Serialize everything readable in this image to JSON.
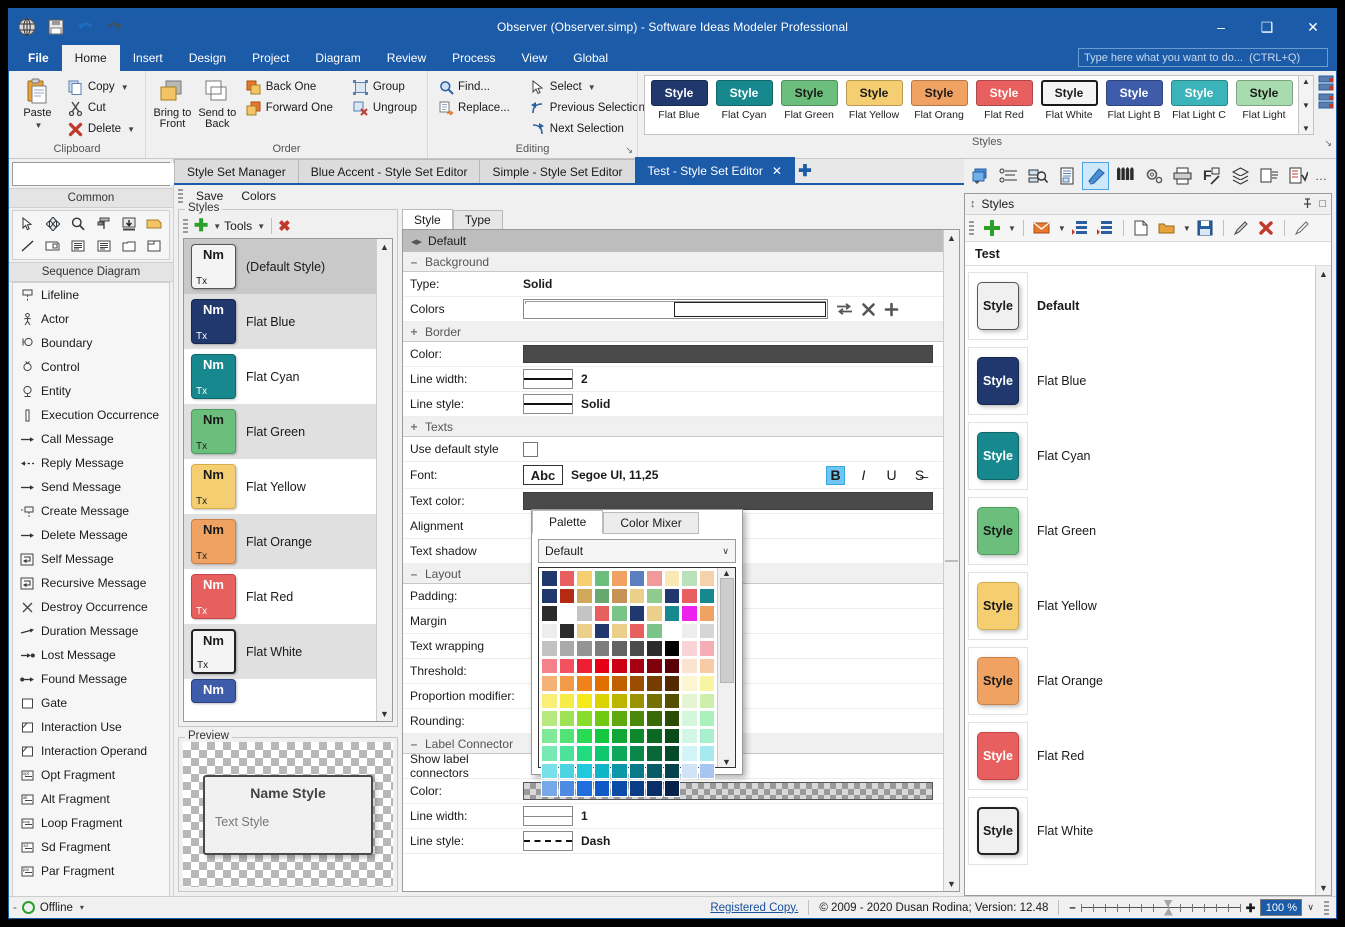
{
  "window": {
    "title": "Observer (Observer.simp)  - Software Ideas Modeler Professional",
    "minimize": "–",
    "maximize": "❑",
    "close": "✕"
  },
  "quick_access": [
    "app-logo-icon",
    "save-icon",
    "undo-icon",
    "redo-icon"
  ],
  "menu": {
    "tabs": [
      {
        "label": "File",
        "active": false,
        "file": true
      },
      {
        "label": "Home",
        "active": true
      },
      {
        "label": "Insert",
        "active": false
      },
      {
        "label": "Design",
        "active": false
      },
      {
        "label": "Project",
        "active": false
      },
      {
        "label": "Diagram",
        "active": false
      },
      {
        "label": "Review",
        "active": false
      },
      {
        "label": "Process",
        "active": false
      },
      {
        "label": "View",
        "active": false
      },
      {
        "label": "Global",
        "active": false
      }
    ],
    "tell_me_placeholder": "Type here what you want to do...  (CTRL+Q)"
  },
  "ribbon": {
    "groups": [
      {
        "name": "Clipboard",
        "big": [
          {
            "label": "Paste",
            "icon": "paste-icon",
            "dropdown": true
          }
        ],
        "small": [
          {
            "label": "Copy",
            "icon": "copy-icon",
            "dropdown": true
          },
          {
            "label": "Cut",
            "icon": "cut-icon",
            "dropdown": false
          },
          {
            "label": "Delete",
            "icon": "delete-icon",
            "dropdown": true
          }
        ]
      },
      {
        "name": "Order",
        "big": [
          {
            "label": "Bring to Front",
            "icon": "bring-to-front-icon"
          },
          {
            "label": "Send to Back",
            "icon": "send-to-back-icon"
          }
        ],
        "small": [
          {
            "label": "Back One",
            "icon": "back-one-icon"
          },
          {
            "label": "Forward One",
            "icon": "forward-one-icon"
          }
        ],
        "small2": [
          {
            "label": "Group",
            "icon": "group-icon"
          },
          {
            "label": "Ungroup",
            "icon": "ungroup-icon"
          }
        ]
      },
      {
        "name": "Editing",
        "small": [
          {
            "label": "Find...",
            "icon": "find-icon"
          },
          {
            "label": "Replace...",
            "icon": "replace-icon"
          }
        ],
        "small2": [
          {
            "label": "Select",
            "icon": "select-icon",
            "dropdown": true
          },
          {
            "label": "Previous Selection",
            "icon": "previous-selection-icon"
          },
          {
            "label": "Next Selection",
            "icon": "next-selection-icon"
          }
        ],
        "dialog_launcher": "↘"
      },
      {
        "name": "Styles",
        "dialog_launcher": "↘"
      }
    ],
    "gallery": {
      "chip_text": "Style",
      "items": [
        {
          "label": "Flat Blue",
          "bg": "#21386e",
          "fg": "#ffffff"
        },
        {
          "label": "Flat Cyan",
          "bg": "#17898e",
          "fg": "#ffffff"
        },
        {
          "label": "Flat Green",
          "bg": "#6cbe7d",
          "fg": "#1a1a1a"
        },
        {
          "label": "Flat Yellow",
          "bg": "#f4ce71",
          "fg": "#1a1a1a"
        },
        {
          "label": "Flat Orang",
          "bg": "#f0a263",
          "fg": "#1a1a1a"
        },
        {
          "label": "Flat Red",
          "bg": "#e85f5f",
          "fg": "#ffffff"
        },
        {
          "label": "Flat White",
          "bg": "#f4f4f4",
          "fg": "#1a1a1a"
        },
        {
          "label": "Flat Light B",
          "bg": "#3f5cab",
          "fg": "#ffffff"
        },
        {
          "label": "Flat Light C",
          "bg": "#3cb3b8",
          "fg": "#ffffff"
        },
        {
          "label": "Flat Light",
          "bg": "#a8dcae",
          "fg": "#1a1a1a"
        }
      ]
    }
  },
  "toolbox": {
    "search_placeholder": "",
    "search_value": "",
    "common_header": "Common",
    "common_icons": [
      "pointer-icon",
      "move-icon",
      "zoom-icon",
      "format-painter-icon",
      "insert-icon",
      "note-icon",
      "line-icon",
      "image-icon",
      "text-block-icon",
      "text-lines-icon",
      "container-icon",
      "frame-icon"
    ],
    "section_header": "Sequence Diagram",
    "items": [
      {
        "label": "Lifeline",
        "icon": "lifeline-icon"
      },
      {
        "label": "Actor",
        "icon": "actor-icon"
      },
      {
        "label": "Boundary",
        "icon": "boundary-icon"
      },
      {
        "label": "Control",
        "icon": "control-icon"
      },
      {
        "label": "Entity",
        "icon": "entity-icon"
      },
      {
        "label": "Execution Occurrence",
        "icon": "execution-occurrence-icon"
      },
      {
        "label": "Call Message",
        "icon": "call-message-icon"
      },
      {
        "label": "Reply Message",
        "icon": "reply-message-icon"
      },
      {
        "label": "Send Message",
        "icon": "send-message-icon"
      },
      {
        "label": "Create Message",
        "icon": "create-message-icon"
      },
      {
        "label": "Delete Message",
        "icon": "delete-message-icon"
      },
      {
        "label": "Self Message",
        "icon": "self-message-icon"
      },
      {
        "label": "Recursive Message",
        "icon": "recursive-message-icon"
      },
      {
        "label": "Destroy Occurrence",
        "icon": "destroy-occurrence-icon"
      },
      {
        "label": "Duration Message",
        "icon": "duration-message-icon"
      },
      {
        "label": "Lost Message",
        "icon": "lost-message-icon"
      },
      {
        "label": "Found Message",
        "icon": "found-message-icon"
      },
      {
        "label": "Gate",
        "icon": "gate-icon"
      },
      {
        "label": "Interaction Use",
        "icon": "interaction-use-icon"
      },
      {
        "label": "Interaction Operand",
        "icon": "interaction-operand-icon"
      },
      {
        "label": "Opt Fragment",
        "icon": "opt-fragment-icon"
      },
      {
        "label": "Alt Fragment",
        "icon": "alt-fragment-icon"
      },
      {
        "label": "Loop Fragment",
        "icon": "loop-fragment-icon"
      },
      {
        "label": "Sd Fragment",
        "icon": "sd-fragment-icon"
      },
      {
        "label": "Par Fragment",
        "icon": "par-fragment-icon"
      }
    ]
  },
  "doc_tabs": {
    "tabs": [
      {
        "label": "Style Set Manager",
        "active": false,
        "closable": false
      },
      {
        "label": "Blue Accent - Style Set Editor",
        "active": false,
        "closable": false
      },
      {
        "label": "Simple - Style Set Editor",
        "active": false,
        "closable": false
      },
      {
        "label": "Test - Style Set Editor",
        "active": true,
        "closable": true
      }
    ],
    "close_glyph": "✕",
    "add_glyph": "✚"
  },
  "editor": {
    "toolbar": [
      {
        "label": "Save"
      },
      {
        "label": "Colors"
      }
    ],
    "styles_group": {
      "legend": "Styles",
      "add_label": "✚",
      "tools_label": "Tools",
      "delete_label": "✖",
      "list": [
        {
          "name": "(Default Style)",
          "bg": "#f4f4f4",
          "fg": "#1a1a1a",
          "border": "#555555",
          "selected": true
        },
        {
          "name": "Flat Blue",
          "bg": "#21386e",
          "fg": "#ffffff",
          "border": "#15264c",
          "alt": true
        },
        {
          "name": "Flat Cyan",
          "bg": "#17898e",
          "fg": "#ffffff",
          "border": "#0f6569"
        },
        {
          "name": "Flat Green",
          "bg": "#6cbe7d",
          "fg": "#1a1a1a",
          "border": "#4c9c5d",
          "alt": true
        },
        {
          "name": "Flat Yellow",
          "bg": "#f4ce71",
          "fg": "#1a1a1a",
          "border": "#d4ac4b"
        },
        {
          "name": "Flat Orange",
          "bg": "#f0a263",
          "fg": "#1a1a1a",
          "border": "#cf8143",
          "alt": true
        },
        {
          "name": "Flat Red",
          "bg": "#e85f5f",
          "fg": "#ffffff",
          "border": "#c54545"
        },
        {
          "name": "Flat White",
          "bg": "#f4f4f4",
          "fg": "#1a1a1a",
          "border": "#222222",
          "alt": true
        },
        {
          "name": "",
          "bg": "#3f5cab",
          "fg": "#ffffff",
          "border": "#2c4183"
        }
      ],
      "chip_name_text": "Nm",
      "chip_text_text": "Tx"
    },
    "preview": {
      "legend": "Preview",
      "name_text": "Name Style",
      "text_text": "Text Style"
    },
    "property_tabs": [
      {
        "label": "Style",
        "active": true
      },
      {
        "label": "Type",
        "active": false
      }
    ],
    "property_header": "Default",
    "sections": [
      {
        "kind": "section",
        "expander": "–",
        "title": "Background"
      },
      {
        "kind": "row",
        "label": "Type:",
        "value": "Solid",
        "control": "text"
      },
      {
        "kind": "row",
        "label": "Colors",
        "control": "gradient",
        "actions": [
          "swap-colors-icon",
          "remove-color-icon",
          "add-color-icon"
        ]
      },
      {
        "kind": "section",
        "expander": "+",
        "title": "Border"
      },
      {
        "kind": "row",
        "label": "Color:",
        "control": "colorbar",
        "color": "#4a4a4a"
      },
      {
        "kind": "row",
        "label": "Line width:",
        "value": "2",
        "control": "linewidth"
      },
      {
        "kind": "row",
        "label": "Line style:",
        "value": "Solid",
        "control": "linestyle-solid"
      },
      {
        "kind": "section",
        "expander": "+",
        "title": "Texts"
      },
      {
        "kind": "row",
        "label": "Use default style",
        "control": "checkbox",
        "checked": false
      },
      {
        "kind": "row",
        "label": "Font:",
        "value": "Segoe UI, 11,25",
        "control": "font",
        "sample": "Abc",
        "format": [
          {
            "name": "bold",
            "glyph": "B",
            "active": true
          },
          {
            "name": "italic",
            "glyph": "I",
            "active": false
          },
          {
            "name": "underline",
            "glyph": "U",
            "active": false
          },
          {
            "name": "strikethrough",
            "glyph": "S̶",
            "active": false
          }
        ]
      },
      {
        "kind": "row",
        "label": "Text color:",
        "control": "colorbar",
        "color": "#4a4a4a"
      },
      {
        "kind": "row",
        "label": "Alignment",
        "control": "none"
      },
      {
        "kind": "row",
        "label": "Text shadow",
        "control": "none"
      },
      {
        "kind": "section",
        "expander": "–",
        "title": "Layout"
      },
      {
        "kind": "row",
        "label": "Padding:",
        "control": "none"
      },
      {
        "kind": "row",
        "label": "Margin",
        "control": "none"
      },
      {
        "kind": "row",
        "label": "Text wrapping",
        "control": "none"
      },
      {
        "kind": "row",
        "label": "Threshold:",
        "control": "none"
      },
      {
        "kind": "row",
        "label": "Proportion modifier:",
        "control": "none"
      },
      {
        "kind": "row",
        "label": "Rounding:",
        "control": "none"
      },
      {
        "kind": "section",
        "expander": "–",
        "title": "Label Connector"
      },
      {
        "kind": "row",
        "label": "Show label connectors",
        "control": "none"
      },
      {
        "kind": "row",
        "label": "Color:",
        "control": "checkerbar"
      },
      {
        "kind": "row",
        "label": "Line width:",
        "value": "1",
        "control": "linewidth-thin"
      },
      {
        "kind": "row",
        "label": "Line style:",
        "value": "Dash",
        "control": "linestyle-dash"
      }
    ],
    "color_picker": {
      "tabs": [
        {
          "label": "Palette",
          "active": true
        },
        {
          "label": "Color Mixer",
          "active": false
        }
      ],
      "selected_palette": "Default",
      "chevron": "∨",
      "palette_colors": [
        "#21386e",
        "#e85f5f",
        "#f4ce71",
        "#6cbe7d",
        "#f0a263",
        "#5b7ec0",
        "#f09a9a",
        "#f8e9b5",
        "#b9e2bb",
        "#f6d2ac",
        "#21386e",
        "#b52a13",
        "#cfa85a",
        "#66a86e",
        "#c79257",
        "#eccf8b",
        "#8fcb8c",
        "#21386e",
        "#e85f5f",
        "#17898e",
        "#2b2b2b",
        "#ffffff",
        "#c4c4c4",
        "#e85f5f",
        "#7bc488",
        "#21386e",
        "#eccf8b",
        "#17898e",
        "#ee22ee",
        "#f0a263",
        "#ededed",
        "#2b2b2b",
        "#eccf8b",
        "#21386e",
        "#eccf8b",
        "#e85f5f",
        "#7bc488",
        "#ffffff",
        "#ededed",
        "#d6d6d6",
        "#c2c2c2",
        "#aaaaaa",
        "#949494",
        "#7d7d7d",
        "#636363",
        "#4b4b4b",
        "#2b2b2b",
        "#000000",
        "#f9d3d6",
        "#f7adb4",
        "#f4828d",
        "#f2515f",
        "#ef1f33",
        "#e60016",
        "#cc0014",
        "#a60010",
        "#80000c",
        "#5c0008",
        "#fae4cf",
        "#f7cba4",
        "#f5b276",
        "#f29a48",
        "#ef821b",
        "#e06f00",
        "#c06000",
        "#9c4e00",
        "#773c00",
        "#552a00",
        "#fbf6cf",
        "#f9f3a4",
        "#f7ef76",
        "#f5ec48",
        "#f3e91b",
        "#dcd200",
        "#bdb400",
        "#9a9300",
        "#757000",
        "#545000",
        "#e4f5d2",
        "#cdefaa",
        "#b6e97f",
        "#9ee355",
        "#87dd2a",
        "#6fc911",
        "#5ea90e",
        "#4c890b",
        "#3a6908",
        "#2a4c06",
        "#d4f7dc",
        "#a9f0ba",
        "#7ee997",
        "#53e275",
        "#28db52",
        "#14c73e",
        "#11a835",
        "#0e882b",
        "#0a6821",
        "#084b18",
        "#d2f7e6",
        "#a6f0cd",
        "#79e9b3",
        "#4de29a",
        "#20db80",
        "#0fc76c",
        "#0da85b",
        "#0a884a",
        "#086838",
        "#064b29",
        "#d2f4f7",
        "#a6eaf0",
        "#79dfe9",
        "#4dd4e2",
        "#20c9db",
        "#0fb4c7",
        "#0d97a8",
        "#0a7a88",
        "#085c68",
        "#06424b",
        "#d2e2f7",
        "#a6c5f0",
        "#79a8e9",
        "#4d8be2",
        "#206edb",
        "#0f59c7",
        "#0d4ba8",
        "#0a3d88",
        "#082f68",
        "#06224b"
      ]
    }
  },
  "right_dock": {
    "tool_icons": [
      "windows-icon",
      "model-tree-icon",
      "diagram-search-icon",
      "documentation-icon",
      "styles-icon",
      "palette-icon",
      "settings-icon",
      "printer-icon",
      "format-icon",
      "layers-icon",
      "notes-icon",
      "tasks-icon",
      "more-icon"
    ],
    "panel": {
      "title": "Styles",
      "pin_glyph": "⚓",
      "maximize_glyph": "□",
      "updown_glyph": "↕",
      "toolbar_icons": [
        "add-style-icon",
        "add-dropdown-icon",
        "apply-style-icon",
        "apply-dropdown-icon",
        "import-styles-icon",
        "export-styles-icon",
        "new-style-set-icon",
        "open-style-set-icon",
        "open-dropdown-icon",
        "save-style-set-icon",
        "edit-style-icon",
        "delete-style-icon",
        "clear-style-icon"
      ],
      "set_name": "Test",
      "chip_text": "Style",
      "items": [
        {
          "name": "Default",
          "bg": "#f0f0f0",
          "fg": "#1a1a1a",
          "border": "#555555",
          "bold": true
        },
        {
          "name": "Flat Blue",
          "bg": "#21386e",
          "fg": "#ffffff",
          "border": "#15264c"
        },
        {
          "name": "Flat Cyan",
          "bg": "#17898e",
          "fg": "#ffffff",
          "border": "#0f6569"
        },
        {
          "name": "Flat Green",
          "bg": "#6cbe7d",
          "fg": "#1a1a1a",
          "border": "#4c9c5d"
        },
        {
          "name": "Flat Yellow",
          "bg": "#f4ce71",
          "fg": "#1a1a1a",
          "border": "#d4ac4b"
        },
        {
          "name": "Flat Orange",
          "bg": "#f0a263",
          "fg": "#1a1a1a",
          "border": "#cf8143"
        },
        {
          "name": "Flat Red",
          "bg": "#e85f5f",
          "fg": "#ffffff",
          "border": "#c54545"
        },
        {
          "name": "Flat White",
          "bg": "#f0f0f0",
          "fg": "#1a1a1a",
          "border": "#222222"
        }
      ]
    }
  },
  "status_bar": {
    "expander": "-",
    "offline_label": "Offline",
    "offline_caret": "▾",
    "registered": "Registered Copy.",
    "copyright": "© 2009 - 2020 Dusan Rodina; Version: 12.48",
    "zoom_out": "–",
    "zoom_in": "✚",
    "zoom_value": "100 %",
    "zoom_caret": "∨"
  }
}
